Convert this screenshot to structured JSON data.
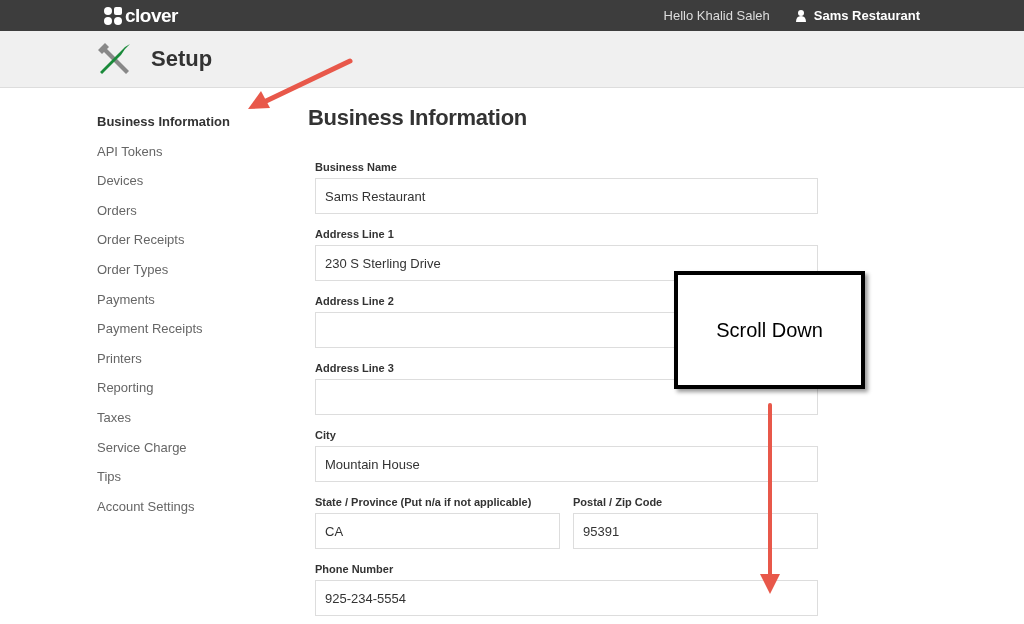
{
  "top_bar": {
    "logo": "clover",
    "greeting": "Hello Khalid Saleh",
    "account": "Sams Restaurant"
  },
  "header": {
    "title": "Setup"
  },
  "sidebar": {
    "items": [
      {
        "label": "Business Information",
        "selected": true
      },
      {
        "label": "API Tokens",
        "selected": false
      },
      {
        "label": "Devices",
        "selected": false
      },
      {
        "label": "Orders",
        "selected": false
      },
      {
        "label": "Order Receipts",
        "selected": false
      },
      {
        "label": "Order Types",
        "selected": false
      },
      {
        "label": "Payments",
        "selected": false
      },
      {
        "label": "Payment Receipts",
        "selected": false
      },
      {
        "label": "Printers",
        "selected": false
      },
      {
        "label": "Reporting",
        "selected": false
      },
      {
        "label": "Taxes",
        "selected": false
      },
      {
        "label": "Service Charge",
        "selected": false
      },
      {
        "label": "Tips",
        "selected": false
      },
      {
        "label": "Account Settings",
        "selected": false
      }
    ]
  },
  "form": {
    "title": "Business Information",
    "rows": [
      {
        "fields": [
          {
            "label": "Business Name",
            "value": "Sams Restaurant"
          }
        ]
      },
      {
        "fields": [
          {
            "label": "Address Line 1",
            "value": "230 S Sterling Drive"
          }
        ]
      },
      {
        "fields": [
          {
            "label": "Address Line 2"
          }
        ]
      },
      {
        "fields": [
          {
            "label": "Address Line 3"
          }
        ]
      },
      {
        "fields": [
          {
            "label": "City",
            "value": "Mountain House"
          }
        ]
      },
      {
        "fields": [
          {
            "label": "State / Province (Put n/a if not applicable)",
            "value": "CA"
          },
          {
            "label": "Postal / Zip Code",
            "value": "95391"
          }
        ]
      },
      {
        "fields": [
          {
            "label": "Phone Number",
            "value": "925-234-5554"
          }
        ]
      }
    ]
  },
  "annotation": {
    "callout": "Scroll Down"
  }
}
